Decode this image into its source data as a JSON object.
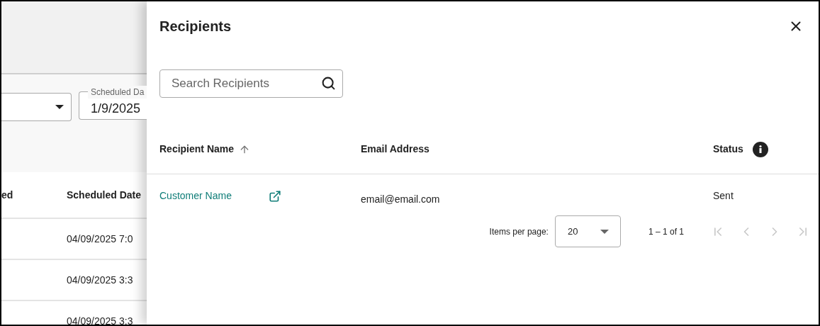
{
  "background_page": {
    "filters": {
      "scheduled_date": {
        "label": "Scheduled Da",
        "value": "1/9/2025"
      }
    },
    "table": {
      "columns": [
        "ed",
        "Scheduled Date"
      ],
      "rows": [
        {
          "scheduled_date": "04/09/2025 7:0"
        },
        {
          "scheduled_date": "04/09/2025 3:3"
        },
        {
          "scheduled_date": "04/09/2025 3:3"
        }
      ]
    }
  },
  "drawer": {
    "title": "Recipients",
    "search": {
      "placeholder": "Search Recipients"
    },
    "table": {
      "columns": [
        {
          "label": "Recipient Name",
          "kind": "sorted"
        },
        {
          "label": "Email Address",
          "kind": "plain"
        },
        {
          "label": "Status",
          "kind": "info"
        }
      ],
      "rows": [
        {
          "name": "Customer Name",
          "email": "email@email.com",
          "status": "Sent"
        }
      ]
    },
    "pagination": {
      "items_per_page_label": "Items per page:",
      "page_size": "20",
      "range": "1 – 1 of 1",
      "buttons": [
        {
          "kind": "first",
          "disabled": true
        },
        {
          "kind": "previous",
          "disabled": true
        },
        {
          "kind": "next",
          "disabled": true
        },
        {
          "kind": "last",
          "disabled": true
        }
      ]
    }
  }
}
